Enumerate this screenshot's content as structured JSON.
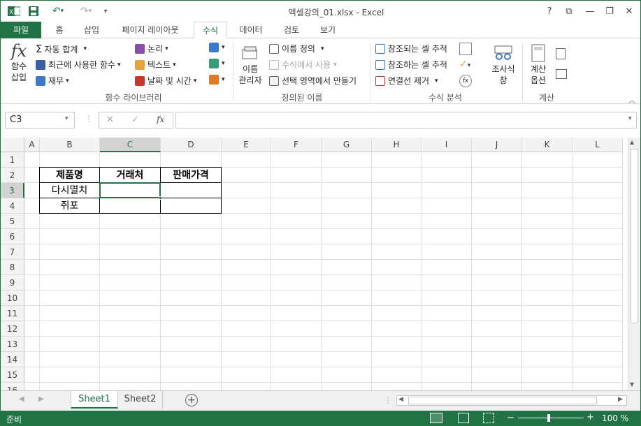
{
  "window": {
    "title": "엑셀강의_01.xlsx - Excel"
  },
  "window_controls": {
    "help": "?",
    "ribbon_display": "⧉",
    "minimize": "—",
    "restore": "❐",
    "close": "✕"
  },
  "tabs": [
    "파일",
    "홈",
    "삽입",
    "페이지 레이아웃",
    "수식",
    "데이터",
    "검토",
    "보기"
  ],
  "ribbon": {
    "insert_function": [
      "함수",
      "삽입"
    ],
    "function_library": {
      "autosum": "자동 합계",
      "recent": "최근에 사용한 함수",
      "financial": "재무",
      "logical": "논리",
      "text": "텍스트",
      "datetime": "날짜 및 시간",
      "label": "함수 라이브러리"
    },
    "defined_names": {
      "name_manager": [
        "이름",
        "관리자"
      ],
      "define_name": "이름 정의",
      "use_in_formula": "수식에서 사용",
      "create_from_selection": "선택 영역에서 만들기",
      "label": "정의된 이름"
    },
    "formula_auditing": {
      "trace_precedents": "참조되는 셀 추적",
      "trace_dependents": "참조하는 셀 추적",
      "remove_arrows": "연결선 제거",
      "watch_window": [
        "조사식",
        "창"
      ],
      "label": "수식 분석"
    },
    "calculation": {
      "options": [
        "계산",
        "옵션"
      ],
      "label": "계산"
    }
  },
  "formula_bar": {
    "name_box": "C3",
    "value": ""
  },
  "grid": {
    "columns": [
      "A",
      "B",
      "C",
      "D",
      "E",
      "F",
      "G",
      "H",
      "I",
      "J",
      "K",
      "L"
    ],
    "rows": [
      "1",
      "2",
      "3",
      "4",
      "5",
      "6",
      "7",
      "8",
      "9",
      "10",
      "11",
      "12",
      "13",
      "14",
      "15",
      "16"
    ],
    "selected_cell": "C3",
    "table": {
      "headers": [
        "제품명",
        "거래처",
        "판매가격"
      ],
      "rows": [
        [
          "다시멸치",
          "",
          ""
        ],
        [
          "쥐포",
          "",
          ""
        ]
      ]
    }
  },
  "sheets": [
    "Sheet1",
    "Sheet2"
  ],
  "status": {
    "ready": "준비",
    "zoom": "100 %"
  },
  "colors": {
    "accent": "#217346"
  }
}
